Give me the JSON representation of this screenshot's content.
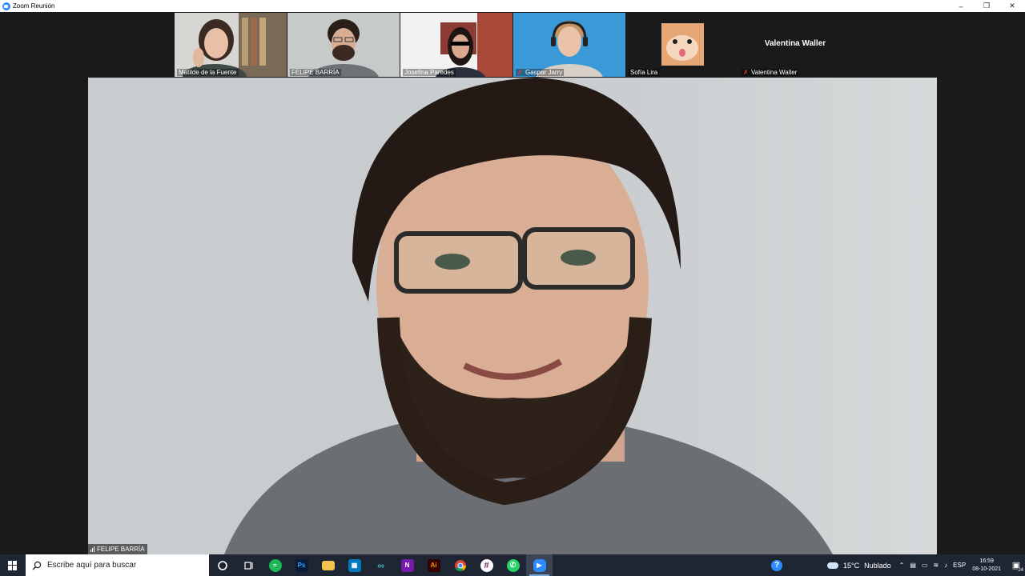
{
  "window": {
    "title": "Zoom Reunión",
    "buttons": [
      "minimize",
      "restore",
      "close"
    ]
  },
  "thumbnails": [
    {
      "name": "Matilde de la Fuente",
      "muted": false,
      "active": false,
      "type": "video"
    },
    {
      "name": "FELIPE BARRÍA",
      "muted": false,
      "active": true,
      "type": "video"
    },
    {
      "name": "Josefina Paredes",
      "muted": false,
      "active": false,
      "type": "video"
    },
    {
      "name": "Gaspar Jarry",
      "muted": true,
      "active": false,
      "type": "video"
    },
    {
      "name": "Sofía Lira",
      "muted": false,
      "active": false,
      "type": "avatar"
    },
    {
      "name": "Valentina Waller",
      "muted": true,
      "active": false,
      "type": "no-video",
      "center_name": "Valentina Waller"
    }
  ],
  "main_speaker": {
    "name": "FELIPE BARRÍA"
  },
  "taskbar": {
    "search_placeholder": "Escribe aquí para buscar",
    "apps": [
      {
        "name": "cortana",
        "label": ""
      },
      {
        "name": "task-view",
        "label": ""
      },
      {
        "name": "spotify",
        "label": ""
      },
      {
        "name": "photoshop",
        "label": "Ps"
      },
      {
        "name": "file-explorer",
        "label": ""
      },
      {
        "name": "trello",
        "label": ""
      },
      {
        "name": "arduino",
        "label": ""
      },
      {
        "name": "onenote",
        "label": "N"
      },
      {
        "name": "illustrator",
        "label": "Ai"
      },
      {
        "name": "chrome",
        "label": ""
      },
      {
        "name": "slack",
        "label": ""
      },
      {
        "name": "whatsapp",
        "label": ""
      },
      {
        "name": "zoom",
        "label": ""
      }
    ],
    "weather": {
      "temp": "15°C",
      "condition": "Nublado"
    },
    "language": "ESP",
    "time": "16:59",
    "date": "08-10-2021",
    "notifications": "24"
  },
  "colors": {
    "zoom_blue": "#2d8cff",
    "active_speaker": "#7cc24b",
    "taskbar": "#1f2633",
    "muted_icon": "#e33333"
  }
}
